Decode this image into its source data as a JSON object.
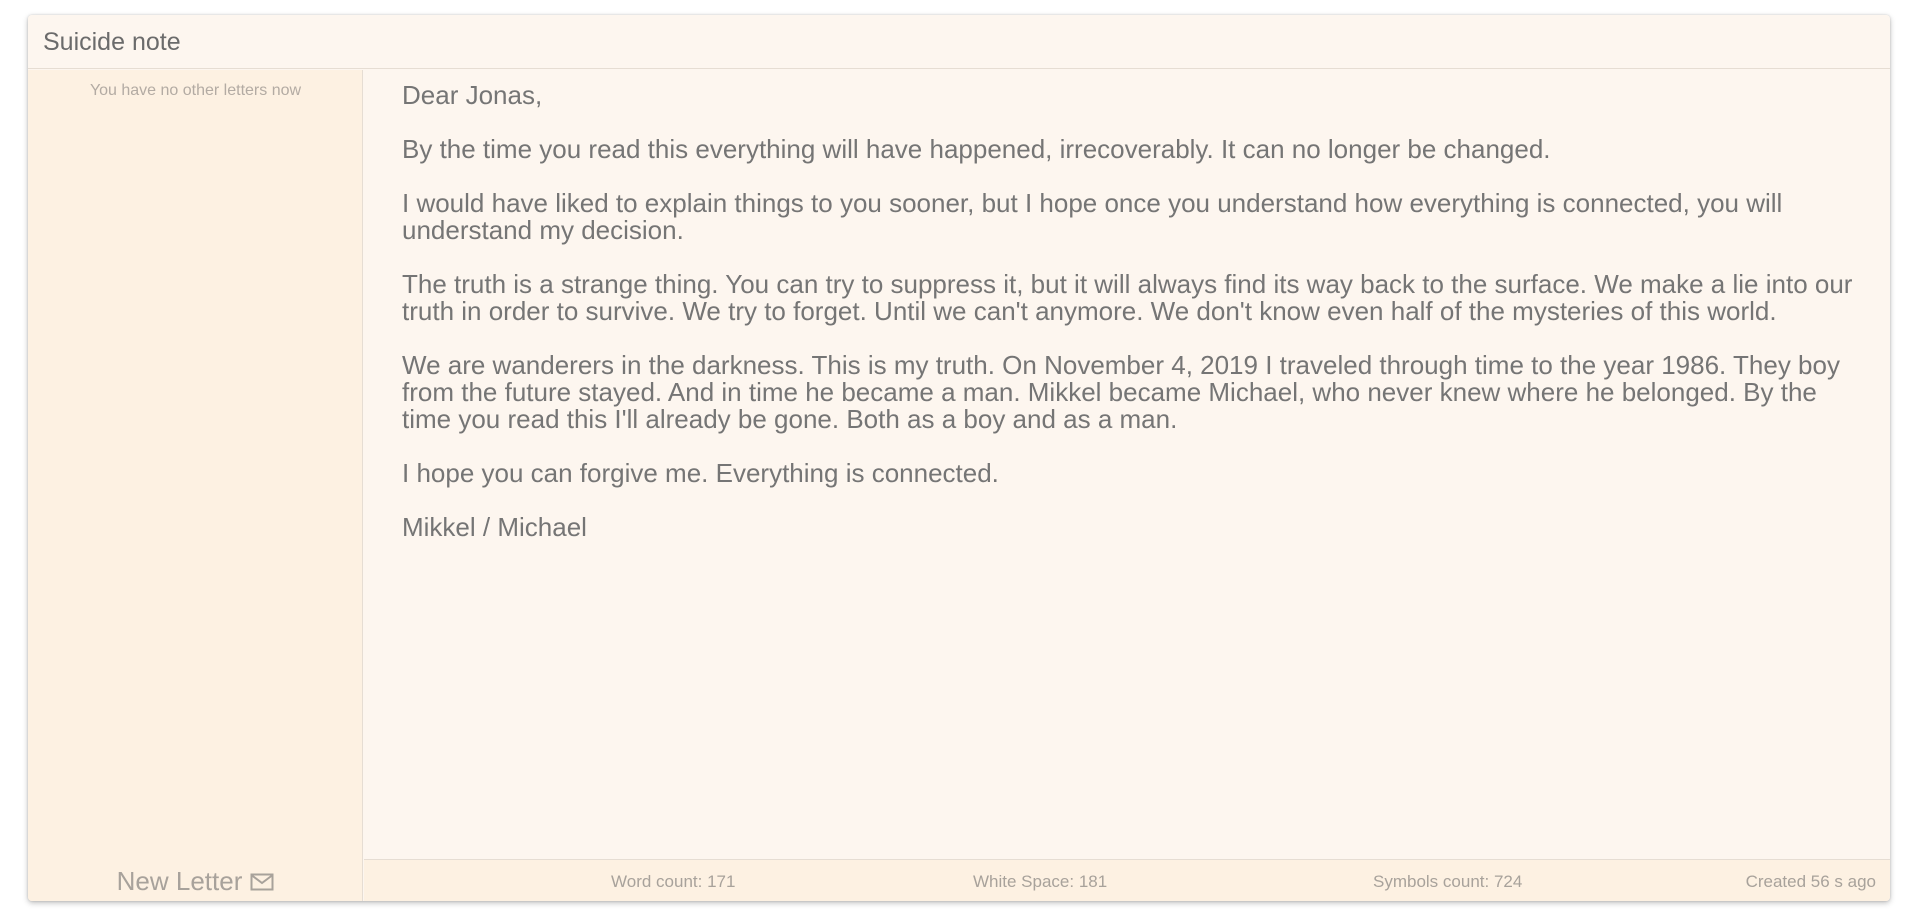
{
  "header": {
    "title": "Suicide note"
  },
  "sidebar": {
    "empty_message": "You have no other letters now",
    "new_letter_label": "New Letter",
    "new_letter_icon": "mail-icon"
  },
  "letter": {
    "paragraphs": [
      "Dear Jonas,",
      "By the time you read this everything will have happened, irrecoverably. It can no longer be changed.",
      "I would have liked to explain things to you sooner, but I hope once you understand how everything is connected, you will understand my decision.",
      "The truth is a strange thing. You can try to suppress it, but it will always find its way back to the surface. We make a lie into our truth in order to survive. We try to forget. Until we can't anymore. We don't know even half of the mysteries of this world.",
      "We are wanderers in the darkness. This is my truth. On November 4, 2019 I traveled through time to the year 1986. They boy from the future stayed. And in time he became a man. Mikkel became Michael, who never knew where he belonged. By the time you read this I'll already be gone. Both as a boy and as a man.",
      "I hope you can forgive me. Everything is connected.",
      "Mikkel / Michael"
    ]
  },
  "status": {
    "word_count": "Word count: 171",
    "white_space": "White Space: 181",
    "symbols_count": "Symbols count: 724",
    "created": "Created 56 s ago"
  },
  "colors": {
    "background": "#fdf6ef",
    "sidebar_background": "#fdf1e2",
    "text": "#757575",
    "muted_text": "#a8a29b"
  }
}
